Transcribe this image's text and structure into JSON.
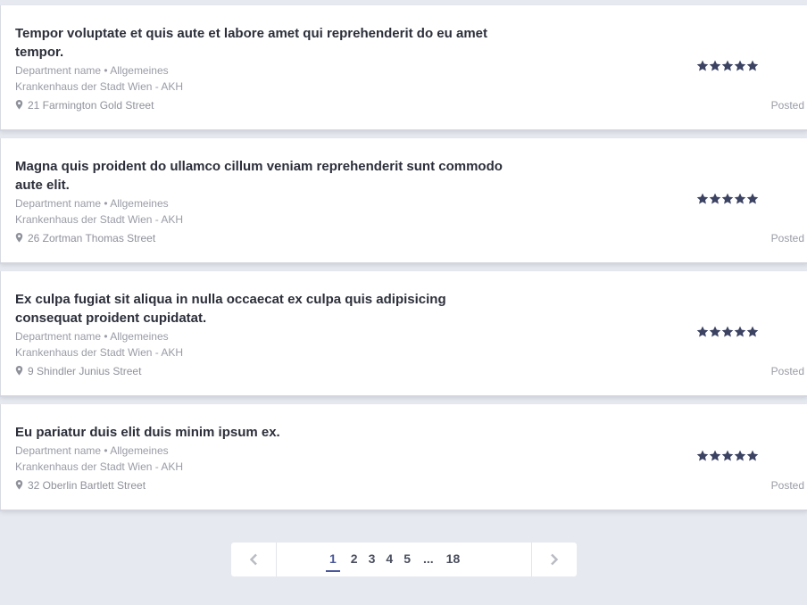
{
  "cards": [
    {
      "title": "Tempor voluptate et quis aute et labore amet qui reprehenderit do eu amet tempor.",
      "department": "Department name • Allgemeines",
      "hospital": "Krankenhaus der Stadt Wien - AKH",
      "address": "21 Farmington Gold Street",
      "rating": 5,
      "posted": "Posted"
    },
    {
      "title": "Magna quis proident do ullamco cillum veniam reprehenderit sunt commodo aute elit.",
      "department": "Department name • Allgemeines",
      "hospital": "Krankenhaus der Stadt Wien - AKH",
      "address": "26 Zortman Thomas Street",
      "rating": 5,
      "posted": "Posted"
    },
    {
      "title": "Ex culpa fugiat sit aliqua in nulla occaecat ex culpa quis adipisicing consequat proident cupidatat.",
      "department": "Department name • Allgemeines",
      "hospital": "Krankenhaus der Stadt Wien - AKH",
      "address": "9 Shindler Junius Street",
      "rating": 5,
      "posted": "Posted"
    },
    {
      "title": "Eu pariatur duis elit duis minim ipsum ex.",
      "department": "Department name • Allgemeines",
      "hospital": "Krankenhaus der Stadt Wien - AKH",
      "address": "32 Oberlin Bartlett Street",
      "rating": 5,
      "posted": "Posted"
    }
  ],
  "pagination": {
    "prev_icon": "chevron-left-icon",
    "next_icon": "chevron-right-icon",
    "pages": [
      "1",
      "2",
      "3",
      "4",
      "5",
      "...",
      "18"
    ],
    "current": "1"
  },
  "colors": {
    "background": "#e7e9f1",
    "star": "#3b4262",
    "active_page": "#4a5899"
  }
}
